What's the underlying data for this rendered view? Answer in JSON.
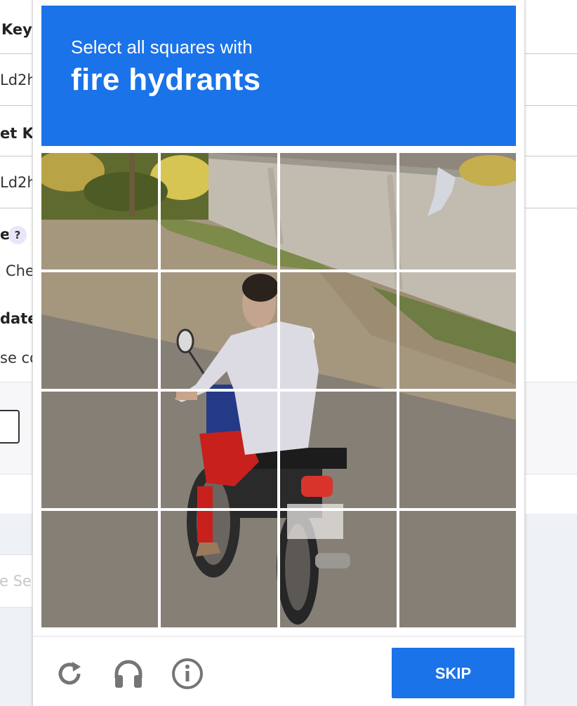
{
  "background_page": {
    "row1_text": "Key",
    "row2_text": "Ld2h",
    "row3_text": "et Ke",
    "row4_text": "Ld2h",
    "row5_text": "e",
    "help_icon": "?",
    "row6_text": "Che",
    "row7_text": "date",
    "row8_text": "se co",
    "button_text": "e Se"
  },
  "captcha": {
    "prompt_line1": "Select all squares with",
    "prompt_target": "fire hydrants",
    "grid_size": 4,
    "skip_label": "SKIP",
    "icons": [
      "reload-icon",
      "headphones-icon",
      "info-icon"
    ],
    "colors": {
      "accent": "#1a73e8",
      "icon_gray": "#757575"
    }
  }
}
